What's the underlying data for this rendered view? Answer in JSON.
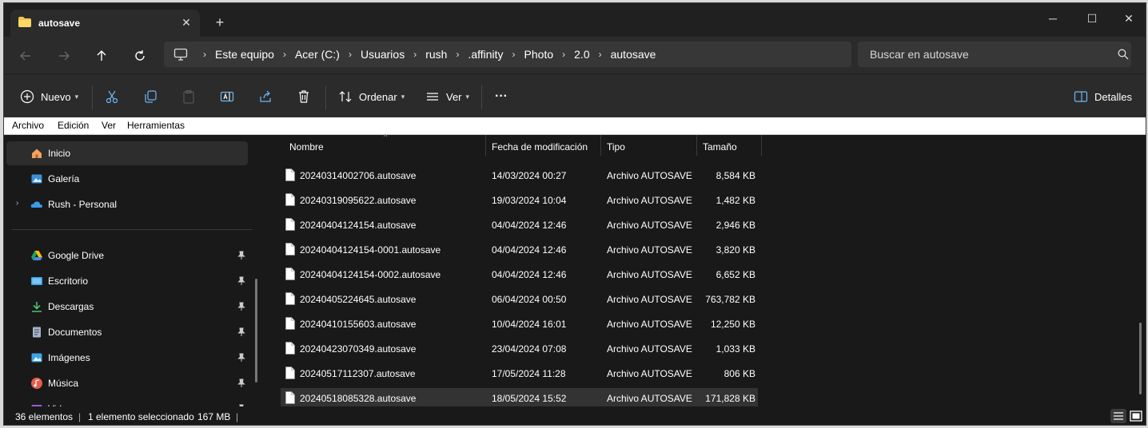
{
  "tab": {
    "title": "autosave",
    "close": "✕",
    "new_tab": "+"
  },
  "window_controls": {
    "minimize": "─",
    "maximize": "☐",
    "close": "✕"
  },
  "address": {
    "crumbs": [
      "Este equipo",
      "Acer (C:)",
      "Usuarios",
      "rush",
      ".affinity",
      "Photo",
      "2.0",
      "autosave"
    ],
    "separator": "›"
  },
  "search": {
    "placeholder": "Buscar en autosave"
  },
  "commands": {
    "new_label": "Nuevo",
    "sort_label": "Ordenar",
    "view_label": "Ver",
    "more_label": "···",
    "details_label": "Detalles"
  },
  "menu": [
    "Archivo",
    "Edición",
    "Ver",
    "Herramientas"
  ],
  "sidebar": {
    "items": [
      {
        "label": "Inicio",
        "icon": "home-icon",
        "selected": true,
        "pinned": false,
        "expander": false
      },
      {
        "label": "Galería",
        "icon": "gallery-icon",
        "selected": false,
        "pinned": false,
        "expander": false
      },
      {
        "label": "Rush - Personal",
        "icon": "onedrive-icon",
        "selected": false,
        "pinned": false,
        "expander": true
      },
      {
        "label": "Google Drive",
        "icon": "google-drive-icon",
        "selected": false,
        "pinned": true,
        "expander": false
      },
      {
        "label": "Escritorio",
        "icon": "desktop-icon",
        "selected": false,
        "pinned": true,
        "expander": false
      },
      {
        "label": "Descargas",
        "icon": "downloads-icon",
        "selected": false,
        "pinned": true,
        "expander": false
      },
      {
        "label": "Documentos",
        "icon": "documents-icon",
        "selected": false,
        "pinned": true,
        "expander": false
      },
      {
        "label": "Imágenes",
        "icon": "pictures-icon",
        "selected": false,
        "pinned": true,
        "expander": false
      },
      {
        "label": "Música",
        "icon": "music-icon",
        "selected": false,
        "pinned": true,
        "expander": false
      },
      {
        "label": "Videos",
        "icon": "videos-icon",
        "selected": false,
        "pinned": true,
        "expander": false
      }
    ],
    "expander_glyph": "›"
  },
  "columns": {
    "name": "Nombre",
    "date": "Fecha de modificación",
    "type": "Tipo",
    "size": "Tamaño"
  },
  "files": [
    {
      "name": "20240314002706.autosave",
      "date": "14/03/2024 00:27",
      "type": "Archivo AUTOSAVE",
      "size": "8,584 KB",
      "selected": false
    },
    {
      "name": "20240319095622.autosave",
      "date": "19/03/2024 10:04",
      "type": "Archivo AUTOSAVE",
      "size": "1,482 KB",
      "selected": false
    },
    {
      "name": "20240404124154.autosave",
      "date": "04/04/2024 12:46",
      "type": "Archivo AUTOSAVE",
      "size": "2,946 KB",
      "selected": false
    },
    {
      "name": "20240404124154-0001.autosave",
      "date": "04/04/2024 12:46",
      "type": "Archivo AUTOSAVE",
      "size": "3,820 KB",
      "selected": false
    },
    {
      "name": "20240404124154-0002.autosave",
      "date": "04/04/2024 12:46",
      "type": "Archivo AUTOSAVE",
      "size": "6,652 KB",
      "selected": false
    },
    {
      "name": "20240405224645.autosave",
      "date": "06/04/2024 00:50",
      "type": "Archivo AUTOSAVE",
      "size": "763,782 KB",
      "selected": false
    },
    {
      "name": "20240410155603.autosave",
      "date": "10/04/2024 16:01",
      "type": "Archivo AUTOSAVE",
      "size": "12,250 KB",
      "selected": false
    },
    {
      "name": "20240423070349.autosave",
      "date": "23/04/2024 07:08",
      "type": "Archivo AUTOSAVE",
      "size": "1,033 KB",
      "selected": false
    },
    {
      "name": "20240517112307.autosave",
      "date": "17/05/2024 11:28",
      "type": "Archivo AUTOSAVE",
      "size": "806 KB",
      "selected": false
    },
    {
      "name": "20240518085328.autosave",
      "date": "18/05/2024 15:52",
      "type": "Archivo AUTOSAVE",
      "size": "171,828 KB",
      "selected": true
    }
  ],
  "status": {
    "count": "36 elementos",
    "selection": "1 elemento seleccionado",
    "size": "167 MB",
    "separator": "|"
  },
  "colors": {
    "accent": "#4cc2ff",
    "folder": "#f4c54a",
    "bg_dark": "#191919",
    "bar_bg": "#2b2b2b"
  }
}
